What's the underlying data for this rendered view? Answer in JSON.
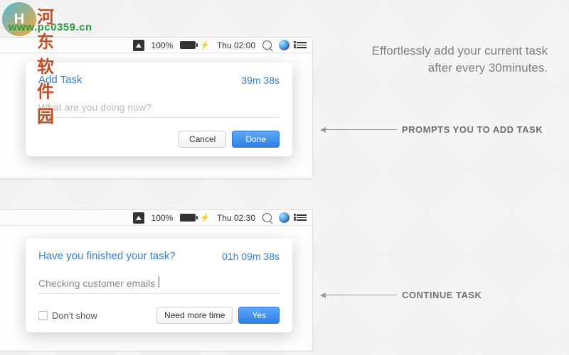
{
  "watermark": {
    "logo_text": "H",
    "site_name": "河东软件园",
    "url": "www.pc0359.cn"
  },
  "headline": "Effortlessly add your current task after every 30minutes.",
  "callouts": {
    "add_task": "PROMPTS YOU TO ADD TASK",
    "continue": "CONTINUE TASK"
  },
  "menubar": {
    "battery_pct_1": "100%",
    "time_1": "Thu 02:00",
    "battery_pct_2": "100%",
    "time_2": "Thu 02:30"
  },
  "add_popup": {
    "title": "Add Task",
    "timer": "39m 38s",
    "placeholder": "What are you doing now?",
    "cancel": "Cancel",
    "done": "Done"
  },
  "finish_popup": {
    "title": "Have you finished your task?",
    "timer": "01h 09m 38s",
    "current_task": "Checking customer emails",
    "dont_show": "Don't show",
    "need_more": "Need more time",
    "yes": "Yes"
  }
}
